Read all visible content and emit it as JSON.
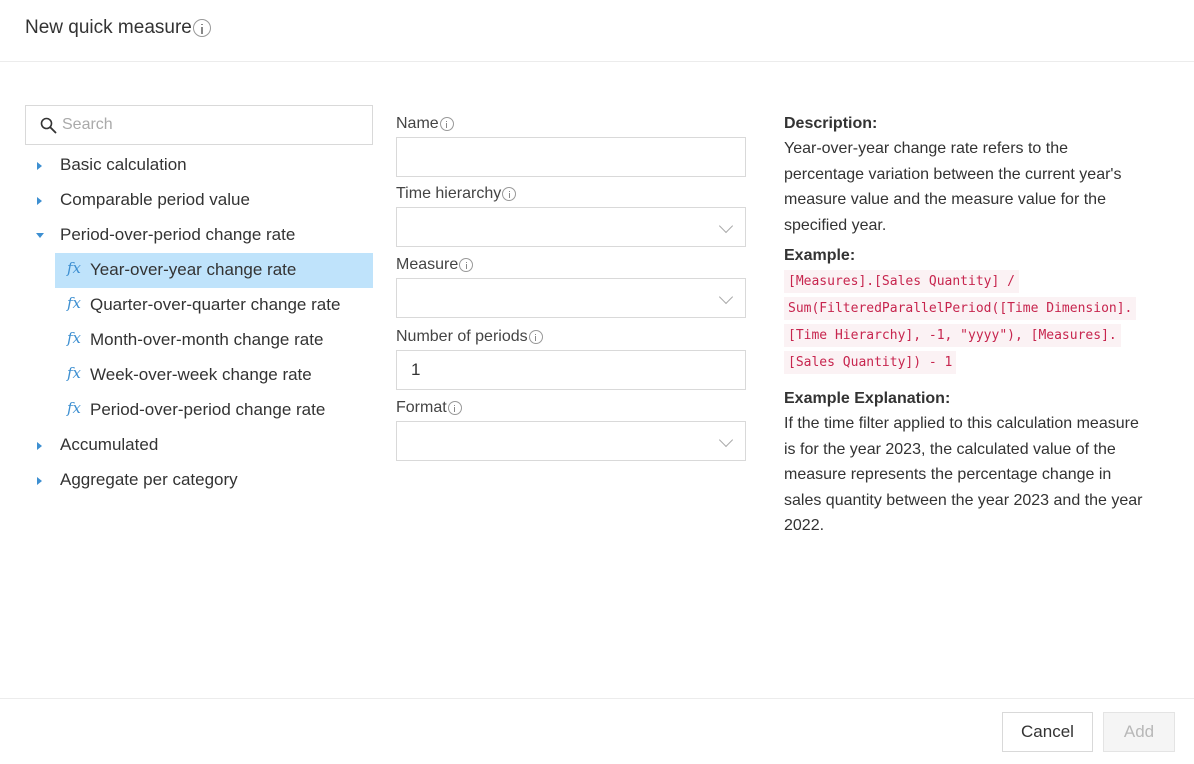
{
  "dialog": {
    "title": "New quick measure"
  },
  "search": {
    "placeholder": "Search",
    "value": ""
  },
  "tree": {
    "items": [
      {
        "label": "Basic calculation",
        "expanded": false
      },
      {
        "label": "Comparable period value",
        "expanded": false
      },
      {
        "label": "Period-over-period change rate",
        "expanded": true,
        "children": [
          {
            "label": "Year-over-year change rate",
            "selected": true
          },
          {
            "label": "Quarter-over-quarter change rate"
          },
          {
            "label": "Month-over-month change rate"
          },
          {
            "label": "Week-over-week change rate"
          },
          {
            "label": "Period-over-period change rate"
          }
        ]
      },
      {
        "label": "Accumulated",
        "expanded": false
      },
      {
        "label": "Aggregate per category",
        "expanded": false
      }
    ],
    "child_icon": "fx"
  },
  "form": {
    "name": {
      "label": "Name",
      "value": ""
    },
    "time_hierarchy": {
      "label": "Time hierarchy",
      "value": ""
    },
    "measure": {
      "label": "Measure",
      "value": ""
    },
    "number_of_periods": {
      "label": "Number of periods",
      "value": "1"
    },
    "format": {
      "label": "Format",
      "value": ""
    }
  },
  "description": {
    "heading": "Description:",
    "text": "Year-over-year change rate refers to the percentage variation between the current year's measure value and the measure value for the specified year.",
    "example_heading": "Example:",
    "example_lines": [
      "[Measures].[Sales Quantity] /",
      "Sum(FilteredParallelPeriod([Time Dimension].",
      "[Time Hierarchy], -1, \"yyyy\"), [Measures].",
      "[Sales Quantity]) - 1"
    ],
    "explanation_heading": "Example Explanation:",
    "explanation_text": "If the time filter applied to this calculation measure is for the year 2023, the calculated value of the measure represents the percentage change in sales quantity between the year 2023 and the year 2022."
  },
  "footer": {
    "cancel_label": "Cancel",
    "add_label": "Add"
  },
  "colors": {
    "accent": "#3d8fd1",
    "selected_bg": "#bfe3fb",
    "code_text": "#c7254e"
  }
}
